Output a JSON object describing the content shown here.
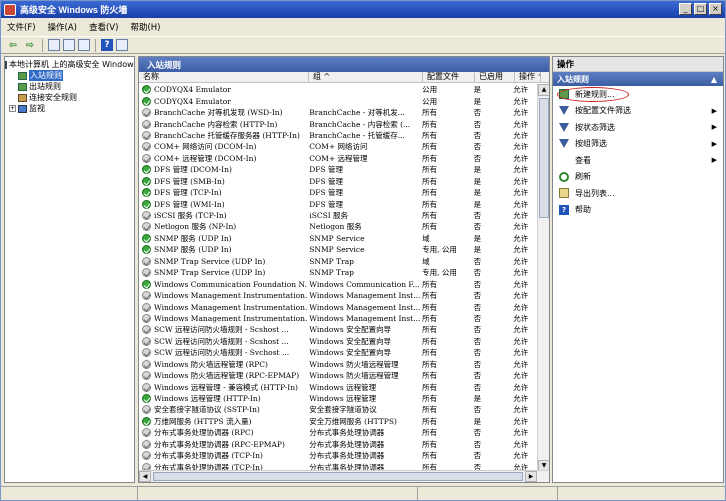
{
  "window": {
    "title": "高级安全 Windows 防火墙",
    "minimize": "_",
    "maximize": "□",
    "close": "×"
  },
  "menu": [
    "文件(F)",
    "操作(A)",
    "查看(V)",
    "帮助(H)"
  ],
  "toolbar": {
    "back": "⇦",
    "forward": "⇨",
    "help": "?"
  },
  "tree": {
    "root": "本地计算机 上的高级安全 Windows",
    "items": [
      {
        "label": "入站规则",
        "selected": true
      },
      {
        "label": "出站规则",
        "selected": false
      },
      {
        "label": "连接安全规则",
        "selected": false
      },
      {
        "label": "监视",
        "selected": false
      }
    ],
    "expander": "+"
  },
  "center": {
    "header": "入站规则",
    "columns": [
      "名称",
      "组 ^",
      "配置文件",
      "已启用",
      "操作 ^"
    ],
    "rows": [
      {
        "name": "CODYQX4 Emulator",
        "group": "",
        "profile": "公用",
        "enabled": "是",
        "action": "允许",
        "on": true
      },
      {
        "name": "CODYQX4 Emulator",
        "group": "",
        "profile": "公用",
        "enabled": "是",
        "action": "允许",
        "on": true
      },
      {
        "name": "BranchCache 对等机发现 (WSD-In)",
        "group": "BranchCache - 对等机发...",
        "profile": "所有",
        "enabled": "否",
        "action": "允许",
        "on": false
      },
      {
        "name": "BranchCache 内容检索 (HTTP-In)",
        "group": "BranchCache - 内容检索 (...",
        "profile": "所有",
        "enabled": "否",
        "action": "允许",
        "on": false
      },
      {
        "name": "BranchCache 托管缓存服务器 (HTTP-In)",
        "group": "BranchCache - 托管缓存...",
        "profile": "所有",
        "enabled": "否",
        "action": "允许",
        "on": false
      },
      {
        "name": "COM+ 网络访问 (DCOM-In)",
        "group": "COM+ 网络访问",
        "profile": "所有",
        "enabled": "否",
        "action": "允许",
        "on": false
      },
      {
        "name": "COM+ 远程管理 (DCOM-In)",
        "group": "COM+ 远程管理",
        "profile": "所有",
        "enabled": "否",
        "action": "允许",
        "on": false
      },
      {
        "name": "DFS 管理 (DCOM-In)",
        "group": "DFS 管理",
        "profile": "所有",
        "enabled": "是",
        "action": "允许",
        "on": true
      },
      {
        "name": "DFS 管理 (SMB-In)",
        "group": "DFS 管理",
        "profile": "所有",
        "enabled": "是",
        "action": "允许",
        "on": true
      },
      {
        "name": "DFS 管理 (TCP-In)",
        "group": "DFS 管理",
        "profile": "所有",
        "enabled": "是",
        "action": "允许",
        "on": true
      },
      {
        "name": "DFS 管理 (WMI-In)",
        "group": "DFS 管理",
        "profile": "所有",
        "enabled": "是",
        "action": "允许",
        "on": true
      },
      {
        "name": "iSCSI 服务 (TCP-In)",
        "group": "iSCSI 服务",
        "profile": "所有",
        "enabled": "否",
        "action": "允许",
        "on": false
      },
      {
        "name": "Netlogon 服务 (NP-In)",
        "group": "Netlogon 服务",
        "profile": "所有",
        "enabled": "否",
        "action": "允许",
        "on": false
      },
      {
        "name": "SNMP 服务 (UDP In)",
        "group": "SNMP Service",
        "profile": "域",
        "enabled": "是",
        "action": "允许",
        "on": true
      },
      {
        "name": "SNMP 服务 (UDP In)",
        "group": "SNMP Service",
        "profile": "专用, 公用",
        "enabled": "是",
        "action": "允许",
        "on": true
      },
      {
        "name": "SNMP Trap Service (UDP In)",
        "group": "SNMP Trap",
        "profile": "域",
        "enabled": "否",
        "action": "允许",
        "on": false
      },
      {
        "name": "SNMP Trap Service (UDP In)",
        "group": "SNMP Trap",
        "profile": "专用, 公用",
        "enabled": "否",
        "action": "允许",
        "on": false
      },
      {
        "name": "Windows Communication Foundation N...",
        "group": "Windows Communication F...",
        "profile": "所有",
        "enabled": "否",
        "action": "允许",
        "on": true
      },
      {
        "name": "Windows Management Instrumentation...",
        "group": "Windows Management Inst...",
        "profile": "所有",
        "enabled": "否",
        "action": "允许",
        "on": false
      },
      {
        "name": "Windows Management Instrumentation...",
        "group": "Windows Management Inst...",
        "profile": "所有",
        "enabled": "否",
        "action": "允许",
        "on": false
      },
      {
        "name": "Windows Management Instrumentation...",
        "group": "Windows Management Inst...",
        "profile": "所有",
        "enabled": "否",
        "action": "允许",
        "on": false
      },
      {
        "name": "SCW 远程访问防火墙规则 - Scshost ...",
        "group": "Windows 安全配置向导",
        "profile": "所有",
        "enabled": "否",
        "action": "允许",
        "on": false
      },
      {
        "name": "SCW 远程访问防火墙规则 - Scshost ...",
        "group": "Windows 安全配置向导",
        "profile": "所有",
        "enabled": "否",
        "action": "允许",
        "on": false
      },
      {
        "name": "SCW 远程访问防火墙规则 - Svchost ...",
        "group": "Windows 安全配置向导",
        "profile": "所有",
        "enabled": "否",
        "action": "允许",
        "on": false
      },
      {
        "name": "Windows 防火墙远程管理 (RPC)",
        "group": "Windows 防火墙远程管理",
        "profile": "所有",
        "enabled": "否",
        "action": "允许",
        "on": false
      },
      {
        "name": "Windows 防火墙远程管理 (RPC-EPMAP)",
        "group": "Windows 防火墙远程管理",
        "profile": "所有",
        "enabled": "否",
        "action": "允许",
        "on": false
      },
      {
        "name": "Windows 远程管理 - 兼容模式 (HTTP-In)",
        "group": "Windows 远程管理",
        "profile": "所有",
        "enabled": "否",
        "action": "允许",
        "on": false
      },
      {
        "name": "Windows 远程管理 (HTTP-In)",
        "group": "Windows 远程管理",
        "profile": "所有",
        "enabled": "是",
        "action": "允许",
        "on": true
      },
      {
        "name": "安全套接字隧道协议 (SSTP-In)",
        "group": "安全套接字隧道协议",
        "profile": "所有",
        "enabled": "否",
        "action": "允许",
        "on": false
      },
      {
        "name": "万维网服务 (HTTPS 流入量)",
        "group": "安全万维网服务 (HTTPS)",
        "profile": "所有",
        "enabled": "是",
        "action": "允许",
        "on": true
      },
      {
        "name": "分布式事务处理协调器 (RPC)",
        "group": "分布式事务处理协调器",
        "profile": "所有",
        "enabled": "否",
        "action": "允许",
        "on": false
      },
      {
        "name": "分布式事务处理协调器 (RPC-EPMAP)",
        "group": "分布式事务处理协调器",
        "profile": "所有",
        "enabled": "否",
        "action": "允许",
        "on": false
      },
      {
        "name": "分布式事务处理协调器 (TCP-In)",
        "group": "分布式事务处理协调器",
        "profile": "所有",
        "enabled": "否",
        "action": "允许",
        "on": false
      },
      {
        "name": "分布式事务处理协调器 (TCP-In)",
        "group": "分布式事务处理协调器",
        "profile": "所有",
        "enabled": "否",
        "action": "允许",
        "on": false
      }
    ]
  },
  "actions": {
    "title": "操作",
    "section": "入站规则",
    "section_arrow": "▲",
    "items": [
      {
        "label": "新建规则...",
        "icon": "new-rule-icon",
        "submenu": false,
        "ringed": true
      },
      {
        "label": "按配置文件筛选",
        "icon": "filter-icon",
        "submenu": true
      },
      {
        "label": "按状态筛选",
        "icon": "filter-icon",
        "submenu": true
      },
      {
        "label": "按组筛选",
        "icon": "filter-icon",
        "submenu": true
      },
      {
        "label": "查看",
        "icon": "view-icon",
        "submenu": true
      },
      {
        "label": "刷新",
        "icon": "refresh-icon",
        "submenu": false
      },
      {
        "label": "导出列表...",
        "icon": "export-icon",
        "submenu": false
      },
      {
        "label": "帮助",
        "icon": "help-icon",
        "submenu": false
      }
    ],
    "submenu_arrow": "▶"
  },
  "colors": {
    "accent": "#3b5da3",
    "enabled_green": "#3aa83a",
    "ring_red": "#d02020"
  }
}
